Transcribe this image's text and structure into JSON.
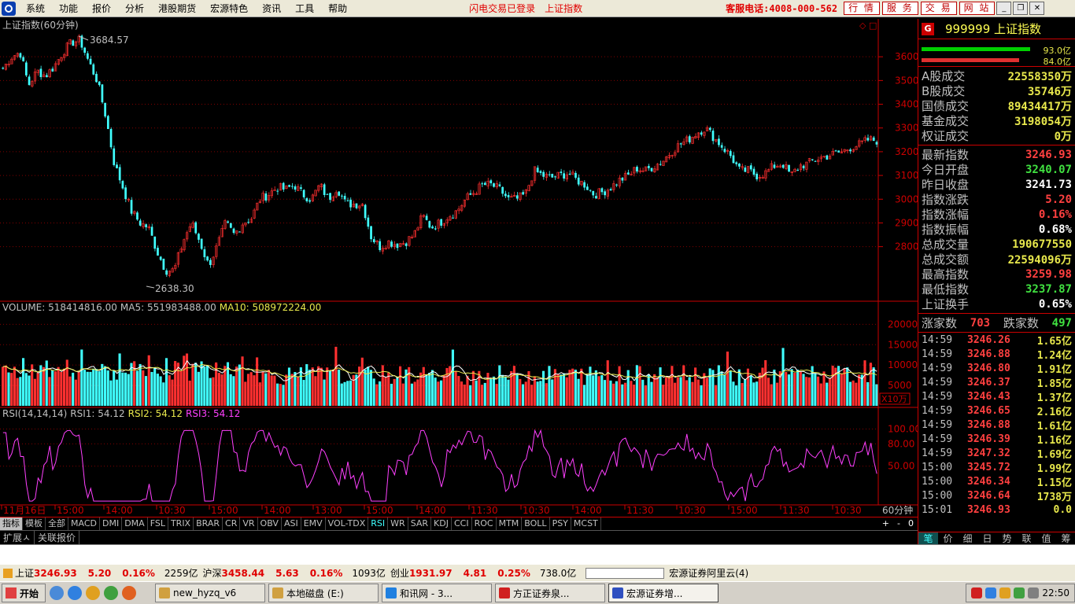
{
  "menu": {
    "items": [
      "系统",
      "功能",
      "报价",
      "分析",
      "港股期货",
      "宏源特色",
      "资讯",
      "工具",
      "帮助"
    ],
    "status1": "闪电交易已登录",
    "status2": "上证指数",
    "phone": "客服电话:4008-000-562",
    "quick": [
      "行 情",
      "服 务",
      "交 易",
      "网 站"
    ],
    "win": [
      "_",
      "❐",
      "✕"
    ]
  },
  "chart": {
    "title": "上证指数(60分钟)",
    "high_label": "3684.57",
    "low_label": "2638.30",
    "price_axis": [
      "3600",
      "3500",
      "3400",
      "3300",
      "3200",
      "3100",
      "3000",
      "2900",
      "2800"
    ],
    "volume_header": {
      "vol": "VOLUME: 518414816.00",
      "ma5": "MA5: 551983488.00",
      "ma10": "MA10: 508972224.00"
    },
    "volume_axis": [
      "20000",
      "15000",
      "10000",
      "5000"
    ],
    "volume_unit": "X10万",
    "rsi_header": {
      "label": "RSI(14,14,14)",
      "r1": "RSI1: 54.12",
      "r2": "RSI2: 54.12",
      "r3": "RSI3: 54.12"
    },
    "rsi_axis": [
      "100.00",
      "80.00",
      "50.00"
    ],
    "time_axis": [
      "11月16日",
      "15:00",
      "14:00",
      "10:30",
      "15:00",
      "14:00",
      "13:00",
      "15:00",
      "14:00",
      "11:30",
      "10:30",
      "14:00",
      "11:30",
      "10:30",
      "15:00",
      "11:30",
      "10:30"
    ],
    "period": "60分钟",
    "ma_colors": {
      "ma5": "#ffffff",
      "ma10": "#ffff00",
      "rsi": "#ff40ff"
    }
  },
  "chart_data": {
    "type": "candlestick",
    "title": "上证指数(60分钟)",
    "ylim": [
      2638.3,
      3684.57
    ],
    "high": 3684.57,
    "low": 2638.3,
    "close_profile": [
      3550,
      3600,
      3620,
      3480,
      3540,
      3520,
      3560,
      3620,
      3660,
      3670,
      3580,
      3500,
      3350,
      3150,
      3050,
      2950,
      2900,
      2880,
      2780,
      2700,
      2700,
      2820,
      2900,
      2820,
      2720,
      2800,
      2900,
      2850,
      2900,
      2920,
      3000,
      3020,
      3050,
      3040,
      3060,
      3020,
      3000,
      3060,
      3000,
      3050,
      2980,
      2980,
      2980,
      2840,
      2800,
      2820,
      2810,
      2820,
      2850,
      2930,
      2880,
      2900,
      2930,
      2950,
      3000,
      3030,
      3060,
      3060,
      3040,
      3000,
      3000,
      3020,
      3120,
      3100,
      3090,
      3100,
      3110,
      3080,
      3060,
      3020,
      3030,
      3050,
      3080,
      3100,
      3130,
      3120,
      3140,
      3160,
      3200,
      3230,
      3250,
      3280,
      3300,
      3260,
      3220,
      3180,
      3120,
      3120,
      3100,
      3110,
      3140,
      3150,
      3100,
      3140,
      3150,
      3170,
      3180,
      3190,
      3200,
      3220,
      3230,
      3250,
      3247
    ],
    "volume_scale": "X10万",
    "rsi_range": [
      0,
      100
    ],
    "rsi_current": 54.12
  },
  "panel": {
    "code": "999999 上证指数",
    "bar_vals": [
      "93.0亿",
      "84.0亿"
    ],
    "rows1": [
      [
        "A股成交",
        "22558350万"
      ],
      [
        "B股成交",
        "35746万"
      ],
      [
        "国债成交",
        "89434417万"
      ],
      [
        "基金成交",
        "3198054万"
      ],
      [
        "权证成交",
        "0万"
      ]
    ],
    "rows2": [
      [
        "最新指数",
        "3246.93",
        "red"
      ],
      [
        "今日开盘",
        "3240.07",
        "green"
      ],
      [
        "昨日收盘",
        "3241.73",
        "white"
      ],
      [
        "指数涨跌",
        "5.20",
        "red"
      ],
      [
        "指数涨幅",
        "0.16%",
        "red"
      ],
      [
        "指数振幅",
        "0.68%",
        "white"
      ],
      [
        "总成交量",
        "190677550",
        "yellow"
      ],
      [
        "总成交额",
        "22594096万",
        "yellow"
      ],
      [
        "最高指数",
        "3259.98",
        "red"
      ],
      [
        "最低指数",
        "3237.87",
        "green"
      ],
      [
        "上证换手",
        "0.65%",
        "white"
      ]
    ],
    "updown": {
      "up_label": "涨家数",
      "up": "703",
      "down_label": "跌家数",
      "down": "497"
    },
    "ticks": [
      [
        "14:59",
        "3246.26",
        "1.65亿"
      ],
      [
        "14:59",
        "3246.88",
        "1.24亿"
      ],
      [
        "14:59",
        "3246.80",
        "1.91亿"
      ],
      [
        "14:59",
        "3246.37",
        "1.85亿"
      ],
      [
        "14:59",
        "3246.43",
        "1.37亿"
      ],
      [
        "14:59",
        "3246.65",
        "2.16亿"
      ],
      [
        "14:59",
        "3246.88",
        "1.61亿"
      ],
      [
        "14:59",
        "3246.39",
        "1.16亿"
      ],
      [
        "14:59",
        "3247.32",
        "1.69亿"
      ],
      [
        "15:00",
        "3245.72",
        "1.99亿"
      ],
      [
        "15:00",
        "3246.34",
        "1.15亿"
      ],
      [
        "15:00",
        "3246.64",
        "1738万"
      ],
      [
        "15:01",
        "3246.93",
        "0.0"
      ]
    ],
    "tabs": [
      "笔",
      "价",
      "细",
      "日",
      "势",
      "联",
      "值",
      "筹"
    ]
  },
  "indicators": [
    "指标",
    "模板",
    "全部",
    "MACD",
    "DMI",
    "DMA",
    "FSL",
    "TRIX",
    "BRAR",
    "CR",
    "VR",
    "OBV",
    "ASI",
    "EMV",
    "VOL-TDX",
    "RSI",
    "WR",
    "SAR",
    "KDJ",
    "CCI",
    "ROC",
    "MTM",
    "BOLL",
    "PSY",
    "MCST"
  ],
  "ind_pm": [
    "+",
    "-",
    "0"
  ],
  "ext": [
    "扩展ㅅ",
    "关联报价"
  ],
  "status": {
    "sh_l": "上证",
    "sh_v": "3246.93",
    "sh_c": "5.20",
    "sh_p": "0.16%",
    "sh_a": "2259亿",
    "hs_l": "沪深",
    "hs_v": "3458.44",
    "hs_c": "5.63",
    "hs_p": "0.16%",
    "hs_a": "1093亿",
    "cy_l": "创业",
    "cy_v": "1931.97",
    "cy_c": "4.81",
    "cy_p": "0.25%",
    "cy_a": "738.0亿",
    "broker": "宏源证券阿里云(4)"
  },
  "taskbar": {
    "start": "开始",
    "tasks": [
      "new_hyzq_v6",
      "本地磁盘 (E:)",
      "和讯网 - 3...",
      "方正证券泉...",
      "宏源证券增..."
    ],
    "time": "22:50"
  }
}
